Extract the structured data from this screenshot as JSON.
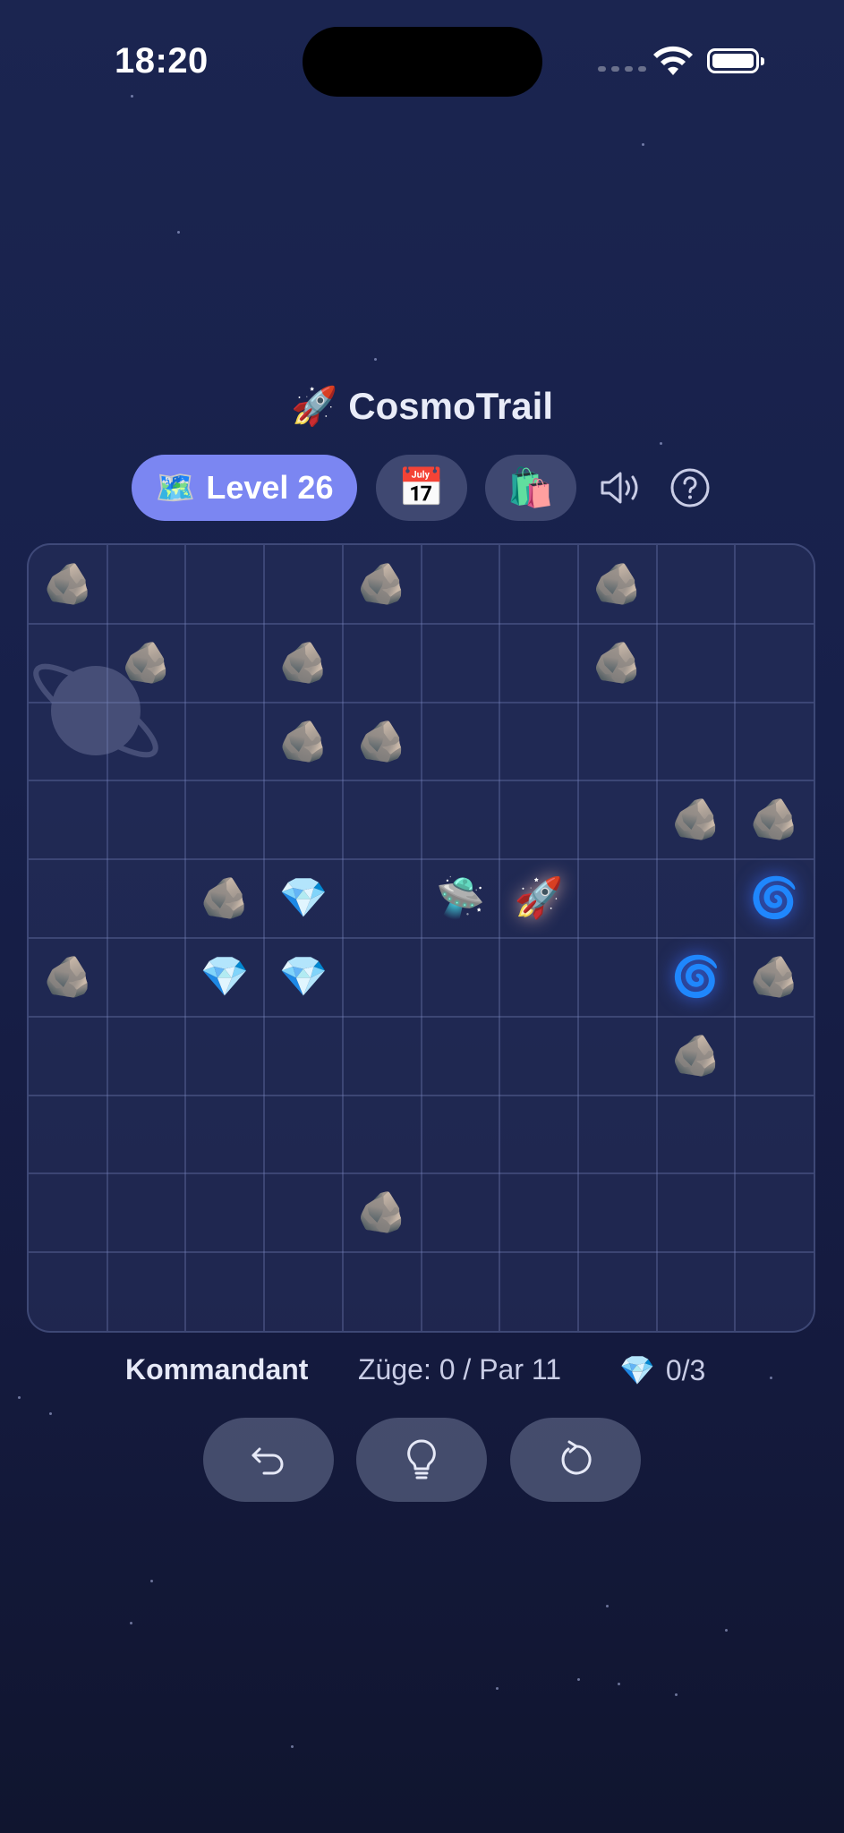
{
  "status_bar": {
    "time": "18:20"
  },
  "header": {
    "title": "CosmoTrail",
    "title_emoji": "🚀"
  },
  "toolbar": {
    "level_emoji": "🗺️",
    "level_label": "Level 26",
    "calendar_emoji": "📅",
    "shop_emoji": "🛍️"
  },
  "board": {
    "columns": 10,
    "rows": 10,
    "items": [
      {
        "type": "asteroid",
        "col": 0,
        "row": 0
      },
      {
        "type": "asteroid",
        "col": 4,
        "row": 0
      },
      {
        "type": "asteroid",
        "col": 7,
        "row": 0
      },
      {
        "type": "asteroid",
        "col": 1,
        "row": 1
      },
      {
        "type": "asteroid",
        "col": 3,
        "row": 1
      },
      {
        "type": "asteroid",
        "col": 7,
        "row": 1
      },
      {
        "type": "asteroid",
        "col": 3,
        "row": 2
      },
      {
        "type": "asteroid",
        "col": 4,
        "row": 2
      },
      {
        "type": "asteroid",
        "col": 8,
        "row": 3
      },
      {
        "type": "asteroid",
        "col": 9,
        "row": 3
      },
      {
        "type": "asteroid",
        "col": 2,
        "row": 4
      },
      {
        "type": "gem",
        "col": 3,
        "row": 4
      },
      {
        "type": "ufo",
        "col": 5,
        "row": 4
      },
      {
        "type": "rocket",
        "col": 6,
        "row": 4
      },
      {
        "type": "wormhole",
        "col": 9,
        "row": 4
      },
      {
        "type": "asteroid",
        "col": 0,
        "row": 5
      },
      {
        "type": "gem",
        "col": 2,
        "row": 5
      },
      {
        "type": "gem",
        "col": 3,
        "row": 5
      },
      {
        "type": "wormhole",
        "col": 8,
        "row": 5
      },
      {
        "type": "asteroid",
        "col": 9,
        "row": 5
      },
      {
        "type": "asteroid",
        "col": 8,
        "row": 6
      },
      {
        "type": "asteroid",
        "col": 4,
        "row": 8
      }
    ]
  },
  "glyphs": {
    "asteroid": "🪨",
    "gem": "💎",
    "ufo": "🛸",
    "rocket": "🚀",
    "wormhole": "🌀"
  },
  "info": {
    "rank": "Kommandant",
    "moves_label": "Züge: 0 / Par 11",
    "gem_emoji": "💎",
    "gems_count": "0/3"
  },
  "icons": {
    "sound": "speaker-icon",
    "help": "question-circle-icon",
    "undo": "undo-arrow-icon",
    "hint": "lightbulb-icon",
    "restart": "restart-arrow-icon"
  },
  "colors": {
    "accent": "#7b86f2",
    "background": "#1b2550"
  }
}
